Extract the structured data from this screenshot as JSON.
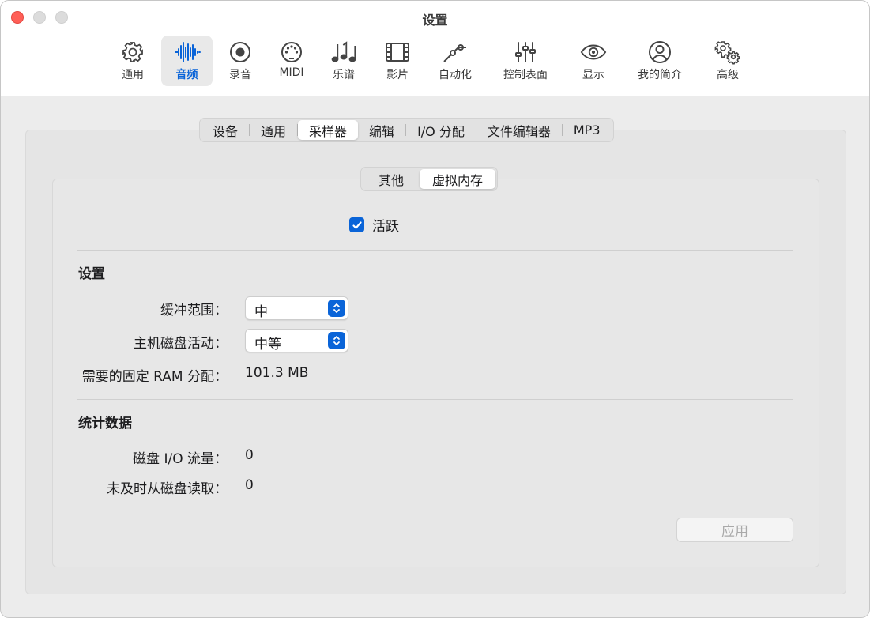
{
  "window": {
    "title": "设置"
  },
  "toolbar": {
    "items": [
      {
        "label": "通用",
        "icon": "gear-icon"
      },
      {
        "label": "音频",
        "icon": "waveform-icon",
        "active": true
      },
      {
        "label": "录音",
        "icon": "record-icon"
      },
      {
        "label": "MIDI",
        "icon": "midi-connector-icon"
      },
      {
        "label": "乐谱",
        "icon": "music-notes-icon"
      },
      {
        "label": "影片",
        "icon": "film-icon"
      },
      {
        "label": "自动化",
        "icon": "automation-curve-icon"
      },
      {
        "label": "控制表面",
        "icon": "sliders-icon"
      },
      {
        "label": "显示",
        "icon": "eye-icon"
      },
      {
        "label": "我的简介",
        "icon": "person-circle-icon"
      },
      {
        "label": "高级",
        "icon": "gears-icon"
      }
    ]
  },
  "tabs": {
    "items": [
      "设备",
      "通用",
      "采样器",
      "编辑",
      "I/O 分配",
      "文件编辑器",
      "MP3"
    ],
    "selected": "采样器"
  },
  "subtabs": {
    "items": [
      "其他",
      "虚拟内存"
    ],
    "selected": "虚拟内存"
  },
  "active_checkbox": {
    "label": "活跃",
    "checked": true
  },
  "settings": {
    "title": "设置",
    "buffer_range": {
      "label": "缓冲范围：",
      "value": "中"
    },
    "host_disk_activity": {
      "label": "主机磁盘活动：",
      "value": "中等"
    },
    "fixed_ram": {
      "label": "需要的固定 RAM 分配：",
      "value": "101.3 MB"
    }
  },
  "stats": {
    "title": "统计数据",
    "disk_io": {
      "label": "磁盘 I/O 流量：",
      "value": "0"
    },
    "late_reads": {
      "label": "未及时从磁盘读取：",
      "value": "0"
    }
  },
  "apply_button": {
    "label": "应用",
    "enabled": false
  },
  "colors": {
    "accent": "#0a64d8",
    "close": "#ff5f57",
    "window_bg": "#ececec",
    "titlebar_bg": "#ffffff"
  }
}
